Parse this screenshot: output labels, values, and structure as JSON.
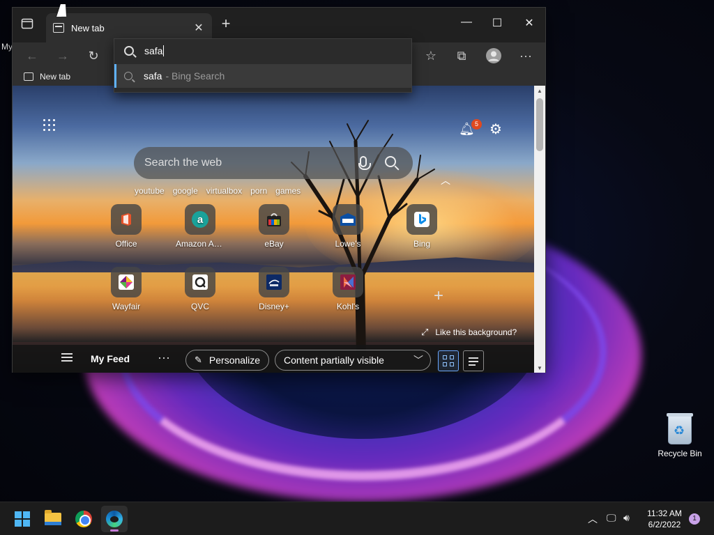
{
  "desktop": {
    "label": "My",
    "recycle_bin_label": "Recycle Bin"
  },
  "browser": {
    "tab": {
      "title": "New tab"
    },
    "new_tab_glyph": "+",
    "window_controls": {
      "minimize": "—",
      "maximize": "☐",
      "close": "✕"
    },
    "favorites_bar": {
      "item_label": "New tab"
    },
    "omnibox": {
      "typed_text": "safa",
      "suggestion": {
        "query": "safa",
        "source": "- Bing Search"
      }
    }
  },
  "newtab": {
    "notification_count": "5",
    "search_placeholder": "Search the web",
    "quick_links": [
      "youtube",
      "google",
      "virtualbox",
      "porn",
      "games"
    ],
    "tiles": [
      {
        "label": "Office",
        "icon": "office-icon"
      },
      {
        "label": "Amazon Assi...",
        "icon": "amazon-icon"
      },
      {
        "label": "eBay",
        "icon": "ebay-icon"
      },
      {
        "label": "Lowe's",
        "icon": "lowes-icon"
      },
      {
        "label": "Bing",
        "icon": "bing-icon"
      },
      {
        "label": "Wayfair",
        "icon": "wayfair-icon"
      },
      {
        "label": "QVC",
        "icon": "qvc-icon"
      },
      {
        "label": "Disney+",
        "icon": "disney-icon"
      },
      {
        "label": "Kohl's",
        "icon": "kohls-icon"
      }
    ],
    "add_tile_glyph": "+",
    "like_background": "Like this background?",
    "feed": {
      "title": "My Feed",
      "more_glyph": "···",
      "personalize": "Personalize",
      "visibility": "Content partially visible"
    }
  },
  "taskbar": {
    "time": "11:32 AM",
    "date": "6/2/2022",
    "notification_count": "1",
    "apps": [
      "start-icon",
      "file-explorer-icon",
      "chrome-icon",
      "edge-icon"
    ]
  },
  "colors": {
    "accent": "#5fb2ff",
    "badge": "#e0491f",
    "taskbar": "#1c1c1c"
  }
}
